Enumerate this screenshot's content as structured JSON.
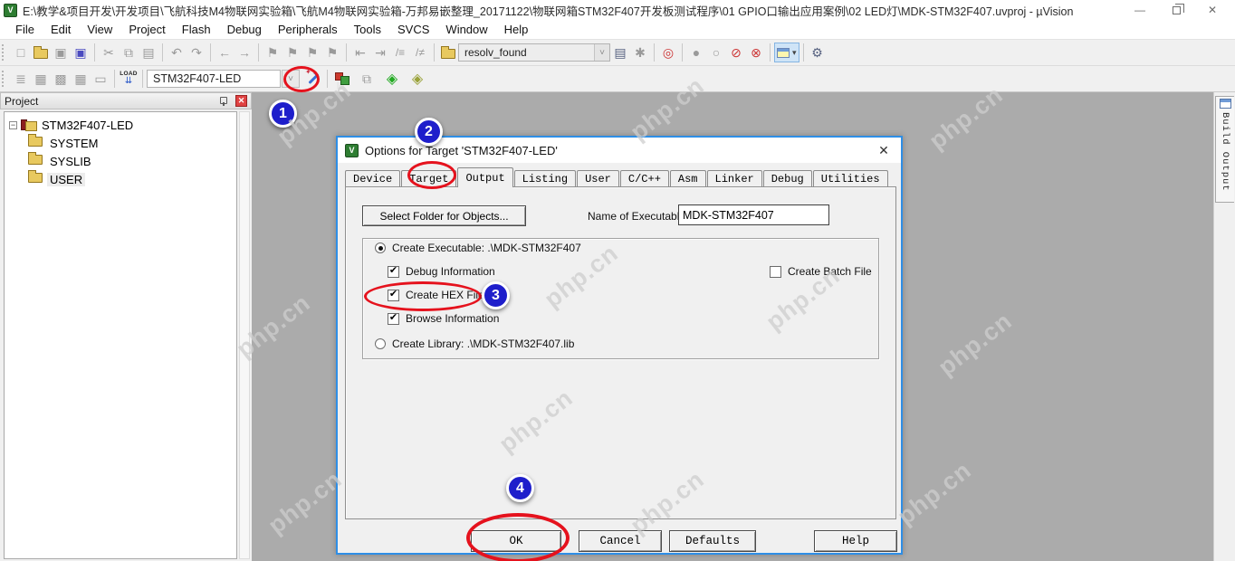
{
  "window": {
    "title": "E:\\教学&项目开发\\开发项目\\飞航科技M4物联网实验箱\\飞航M4物联网实验箱-万邦易嵌整理_20171122\\物联网箱STM32F407开发板测试程序\\01 GPIO口输出应用案例\\02 LED灯\\MDK-STM32F407.uvproj - µVision",
    "logo_text": "V"
  },
  "glyphs": {
    "minimize": "—",
    "close": "✕",
    "dialog_close": "✕",
    "check": "✔",
    "dropdown": "˅",
    "expander_minus": "−"
  },
  "menu": {
    "items": [
      "File",
      "Edit",
      "View",
      "Project",
      "Flash",
      "Debug",
      "Peripherals",
      "Tools",
      "SVCS",
      "Window",
      "Help"
    ]
  },
  "toolbar1": {
    "search_value": "resolv_found",
    "icons": {
      "new_file": "□",
      "save": "▣",
      "save_all": "▣",
      "cut": "✂",
      "copy": "⧉",
      "paste": "▤",
      "undo": "↶",
      "redo": "↷",
      "nav_back": "←",
      "nav_forward": "→",
      "bookmark_toggle": "⚑",
      "bookmark_next": "⚑",
      "bookmark_prev": "⚑",
      "bookmark_clear": "⚑",
      "unindent": "⇤",
      "indent": "⇥",
      "comment": "/≡",
      "uncomment": "/≠",
      "find_in_files": "▤",
      "incremental_find": "✱",
      "book_search": "◎",
      "bp_insert": "●",
      "bp_disable": "○",
      "bp_disable_all": "⊘",
      "bp_kill_all": "⊗",
      "wrench": "⚙"
    }
  },
  "toolbar2": {
    "target_value": "STM32F407-LED",
    "load_label": "LOAD",
    "load_arrows": "⇊",
    "icons": {
      "translate": "≣",
      "build": "▦",
      "rebuild": "▩",
      "batch_build": "▦",
      "stop_build": "▭",
      "multiproject": "⧉",
      "runtime_env": "◈",
      "pack_installer": "◈"
    }
  },
  "project_panel": {
    "title": "Project",
    "root_label": "STM32F407-LED",
    "folders": [
      "SYSTEM",
      "SYSLIB",
      "USER"
    ]
  },
  "build_output_tab": {
    "label": "Build Output"
  },
  "dialog": {
    "title": "Options for Target 'STM32F407-LED'",
    "logo_text": "V",
    "tabs": [
      "Device",
      "Target",
      "Output",
      "Listing",
      "User",
      "C/C++",
      "Asm",
      "Linker",
      "Debug",
      "Utilities"
    ],
    "active_tab": "Output",
    "select_folder_button": "Select Folder for Objects...",
    "name_of_executable_label": "Name of Executable:",
    "executable_name": "MDK-STM32F407",
    "create_executable_label": "Create Executable:  .\\MDK-STM32F407",
    "debug_information_label": "Debug Information",
    "create_hex_label": "Create HEX File",
    "browse_information_label": "Browse Information",
    "create_library_label": "Create Library: .\\MDK-STM32F407.lib",
    "create_batch_label": "Create Batch File",
    "states": {
      "create_executable": "selected",
      "create_library": "unselected",
      "debug_information": "checked",
      "create_hex": "checked",
      "browse_information": "checked",
      "create_batch": "unchecked"
    },
    "buttons": [
      "OK",
      "Cancel",
      "Defaults",
      "Help"
    ]
  },
  "annotations": {
    "badges": [
      "1",
      "2",
      "3",
      "4"
    ]
  },
  "watermark": {
    "text": "php.cn"
  }
}
